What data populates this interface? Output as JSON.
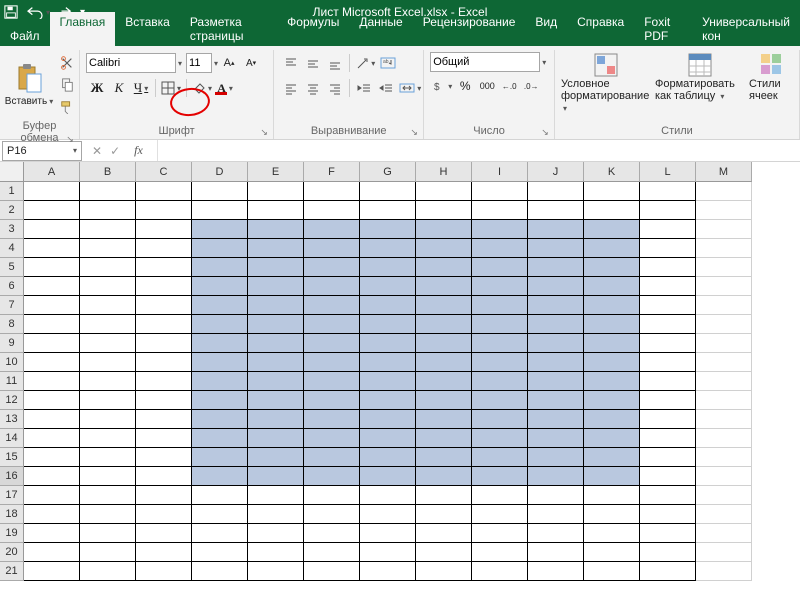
{
  "title": "Лист Microsoft Excel.xlsx  -  Excel",
  "qat": {
    "save": "save-icon",
    "undo": "undo-icon",
    "redo": "redo-icon"
  },
  "tabs": {
    "file": "Файл",
    "items": [
      "Главная",
      "Вставка",
      "Разметка страницы",
      "Формулы",
      "Данные",
      "Рецензирование",
      "Вид",
      "Справка",
      "Foxit PDF",
      "Универсальный кон"
    ],
    "active_index": 0
  },
  "ribbon": {
    "clipboard": {
      "paste": "Вставить",
      "label": "Буфер обмена"
    },
    "font": {
      "family": "Calibri",
      "size": "11",
      "increase": "A▲",
      "decrease": "A▼",
      "bold": "Ж",
      "italic": "К",
      "underline": "Ч",
      "borders": "⊞",
      "fill": "◆",
      "color": "A",
      "label": "Шрифт"
    },
    "alignment": {
      "wrap": "ab⇲",
      "merge": "⊡",
      "label": "Выравнивание"
    },
    "number": {
      "format": "Общий",
      "currency": "₽",
      "percent": "%",
      "comma": "000",
      "inc": "←,0",
      "dec": ",0→",
      "label": "Число"
    },
    "styles": {
      "cond": "Условное форматирование",
      "table": "Форматировать как таблицу",
      "cell": "Стили ячеек",
      "label": "Стили"
    }
  },
  "namebox": "P16",
  "formula_bar": {
    "cancel": "✕",
    "enter": "✓",
    "fx": "fx",
    "value": ""
  },
  "grid": {
    "columns": [
      "A",
      "B",
      "C",
      "D",
      "E",
      "F",
      "G",
      "H",
      "I",
      "J",
      "K",
      "L",
      "M"
    ],
    "rows": [
      1,
      2,
      3,
      4,
      5,
      6,
      7,
      8,
      9,
      10,
      11,
      12,
      13,
      14,
      15,
      16,
      17,
      18,
      19,
      20,
      21
    ],
    "selection": {
      "c1": "D",
      "r1": 3,
      "c2": "K",
      "r2": 16
    },
    "active_row": 16,
    "bordered_cols": [
      "A",
      "B",
      "C",
      "D",
      "E",
      "F",
      "G",
      "H",
      "I",
      "J",
      "K",
      "L"
    ],
    "bordered_rows_max": 21
  }
}
